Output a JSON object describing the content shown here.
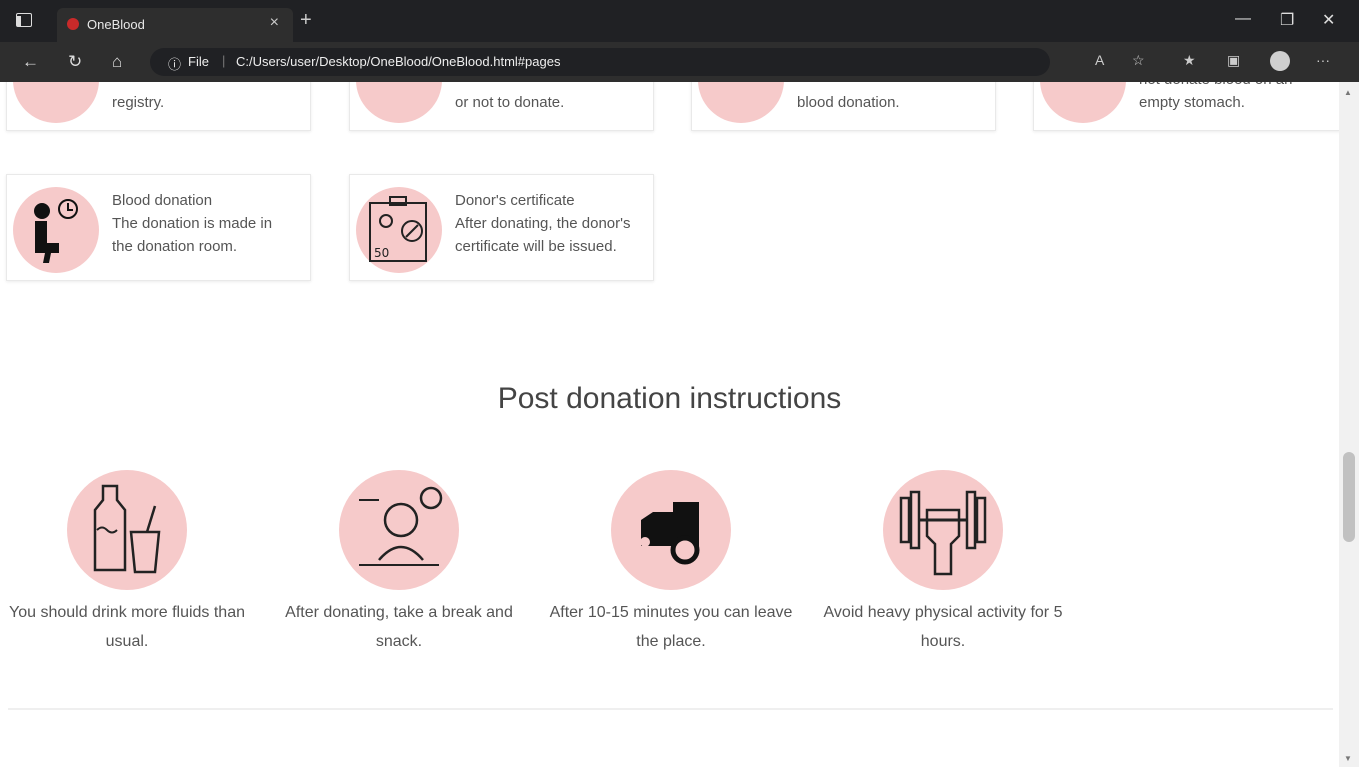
{
  "browser": {
    "tab_title": "OneBlood",
    "address_file_label": "File",
    "address_url": "C:/Users/user/Desktop/OneBlood/OneBlood.html#pages"
  },
  "top_cards": [
    {
      "text": "registry."
    },
    {
      "text": "or not to donate."
    },
    {
      "text": "blood donation."
    },
    {
      "text": "not donate blood on an empty stomach."
    }
  ],
  "steps": [
    {
      "title": "Blood donation",
      "desc": "The donation is made in the donation room."
    },
    {
      "title": "Donor's certificate",
      "desc": "After donating, the donor's certificate will be issued."
    }
  ],
  "post": {
    "title": "Post donation instructions",
    "items": [
      {
        "text": "You should drink more fluids than usual."
      },
      {
        "text": "After donating, take a break and snack."
      },
      {
        "text": "After 10-15 minutes you can leave the place."
      },
      {
        "text": "Avoid heavy physical activity for 5 hours."
      }
    ]
  },
  "colors": {
    "accent_pink": "#f6caca",
    "favicon_red": "#c92a2a",
    "text_gray": "#555555"
  }
}
